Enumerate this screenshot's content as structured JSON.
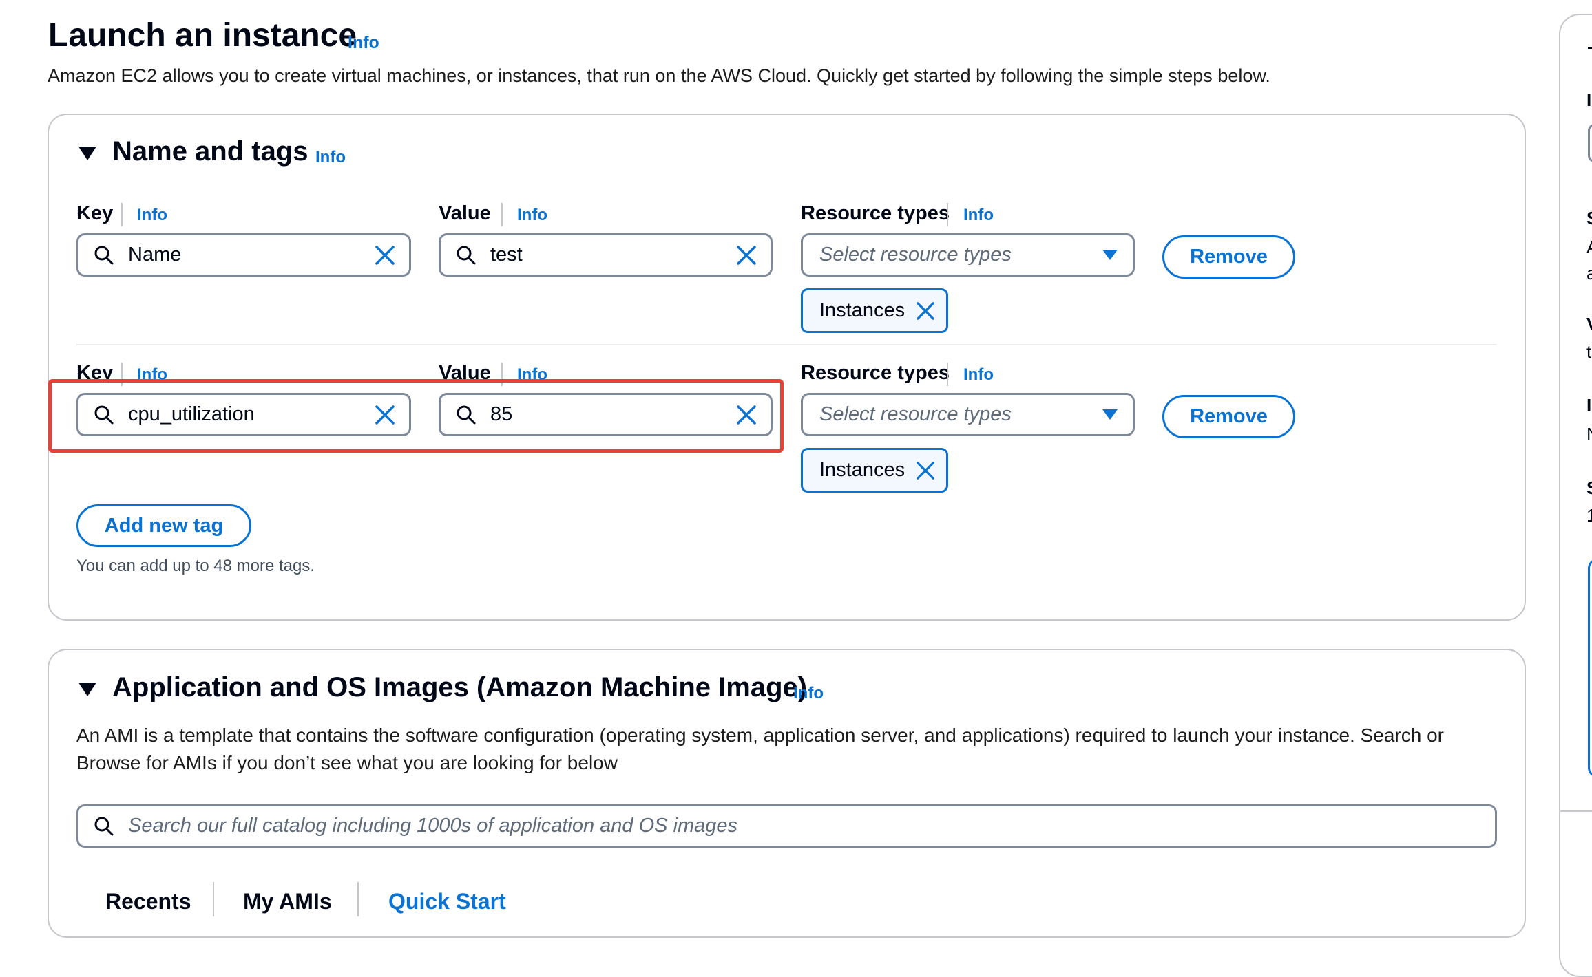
{
  "page": {
    "title": "Launch an instance",
    "info_label": "Info",
    "description": "Amazon EC2 allows you to create virtual machines, or instances, that run on the AWS Cloud. Quickly get started by following the simple steps below."
  },
  "name_and_tags": {
    "title": "Name and tags",
    "info_label": "Info",
    "key_label": "Key",
    "value_label": "Value",
    "resource_types_label": "Resource types",
    "resource_placeholder": "Select resource types",
    "remove_label": "Remove",
    "tags": [
      {
        "key": "Name",
        "value": "test",
        "token": "Instances"
      },
      {
        "key": "cpu_utilization",
        "value": "85",
        "token": "Instances"
      }
    ],
    "add_tag_label": "Add new tag",
    "hint": "You can add up to 48 more tags."
  },
  "ami": {
    "title": "Application and OS Images (Amazon Machine Image)",
    "info_label": "Info",
    "description": "An AMI is a template that contains the software configuration (operating system, application server, and applications) required to launch your instance. Search or Browse for AMIs if you don’t see what you are looking for below",
    "search_placeholder": "Search our full catalog including 1000s of application and OS images",
    "tabs": [
      "Recents",
      "My AMIs",
      "Quick Start"
    ]
  },
  "right_panel": {
    "chars": [
      "I",
      "S",
      "A",
      "a",
      "V",
      "t",
      "I",
      "N",
      "S",
      "1"
    ]
  },
  "colors": {
    "link": "#0972d3",
    "highlight": "#e8413a",
    "border": "#7d8998",
    "text": "#000716"
  }
}
